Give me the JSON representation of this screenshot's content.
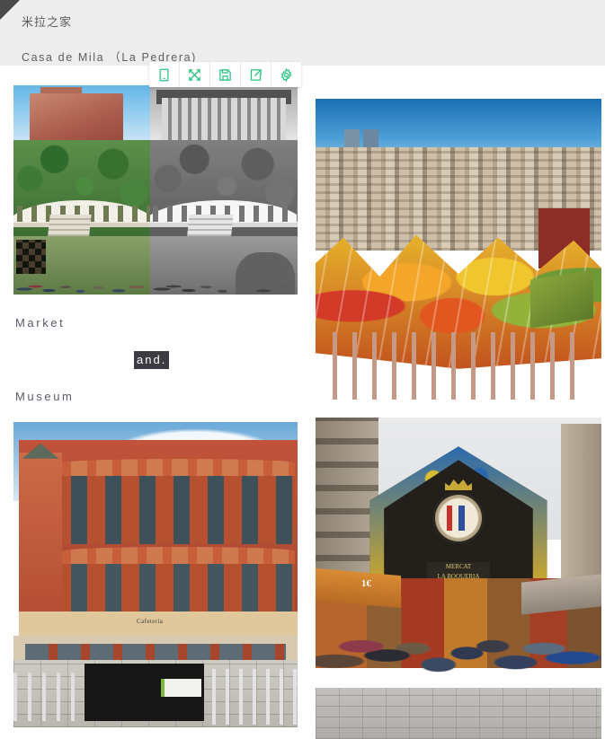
{
  "header": {
    "title_cn": "米拉之家",
    "title_en": "Casa de Mila （La Pedrera)"
  },
  "toolbar": {
    "buttons": [
      {
        "name": "mobile-preview-icon",
        "label": "Mobile preview"
      },
      {
        "name": "fullscreen-icon",
        "label": "Fullscreen"
      },
      {
        "name": "save-icon",
        "label": "Save"
      },
      {
        "name": "share-icon",
        "label": "Share"
      },
      {
        "name": "settings-gear-icon",
        "label": "Settings"
      }
    ],
    "accent_color": "#28c281",
    "background_color": "#ffffff"
  },
  "captions": {
    "market": "Market",
    "and": "and.",
    "museum": "Museum",
    "highlight_bg": "#3b3b42",
    "highlight_fg": "#ffffff",
    "text_color": "#5b5b68"
  },
  "photos": [
    {
      "name": "park-guell-split",
      "alt": "Park Güell terrace and colonnade, left half colour right half black and white"
    },
    {
      "name": "santa-caterina-market-roof",
      "alt": "Aerial view of Santa Caterina Market colourful undulating roof over Barcelona"
    },
    {
      "name": "caixaforum-casaramona",
      "alt": "Red brick modernist Casaramona / CaixaForum facade with plaza cafe chairs",
      "sign_text": "Cafeteria"
    },
    {
      "name": "la-boqueria-entrance",
      "alt": "La Boqueria market entrance on La Rambla with crowd and stained glass arch",
      "crest_banner": "MERCAT\nLA BOQUERIA",
      "stall_price": "1€"
    }
  ],
  "colors": {
    "header_background": "#ededed",
    "page_background": "#ffffff",
    "corner_fold": "#4a4a4a"
  }
}
